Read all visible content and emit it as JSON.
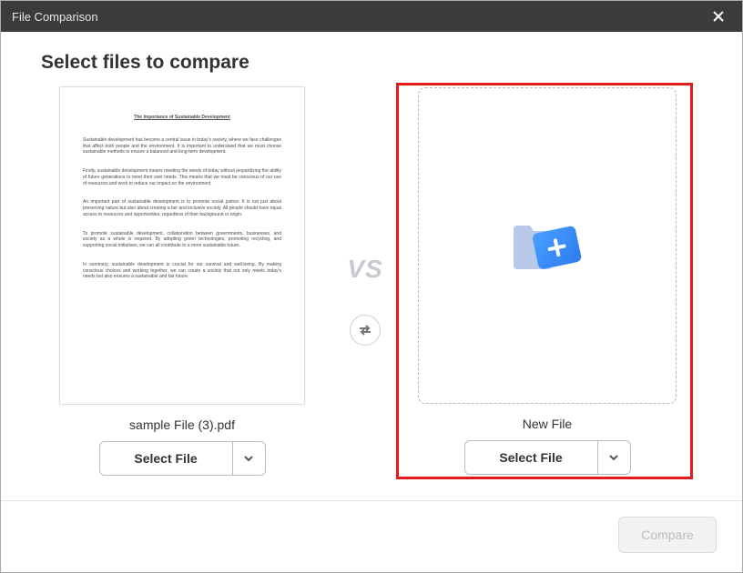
{
  "titlebar": {
    "title": "File Comparison"
  },
  "heading": "Select files to compare",
  "left": {
    "doc_title": "The Importance of Sustainable Development",
    "paragraphs": [
      "Sustainable development has become a central issue in today's society, where we face challenges that affect both people and the environment. It is important to understand that we must choose sustainable methods to ensure a balanced and long-term development.",
      "Firstly, sustainable development means meeting the needs of today without jeopardizing the ability of future generations to meet their own needs. This means that we must be conscious of our use of resources and work to reduce our impact on the environment.",
      "An important part of sustainable development is to promote social justice. It is not just about preserving nature but also about creating a fair and inclusive society. All people should have equal access to resources and opportunities, regardless of their background or origin.",
      "To promote sustainable development, collaboration between governments, businesses, and society as a whole is required. By adopting green technologies, promoting recycling, and supporting social initiatives, we can all contribute to a more sustainable future.",
      "In summary, sustainable development is crucial for our survival and well-being. By making conscious choices and working together, we can create a society that not only meets today's needs but also ensures a sustainable and fair future."
    ],
    "filename": "sample File (3).pdf",
    "select_label": "Select File"
  },
  "middle": {
    "vs": "VS"
  },
  "right": {
    "label": "New File",
    "select_label": "Select File"
  },
  "footer": {
    "compare_label": "Compare"
  }
}
